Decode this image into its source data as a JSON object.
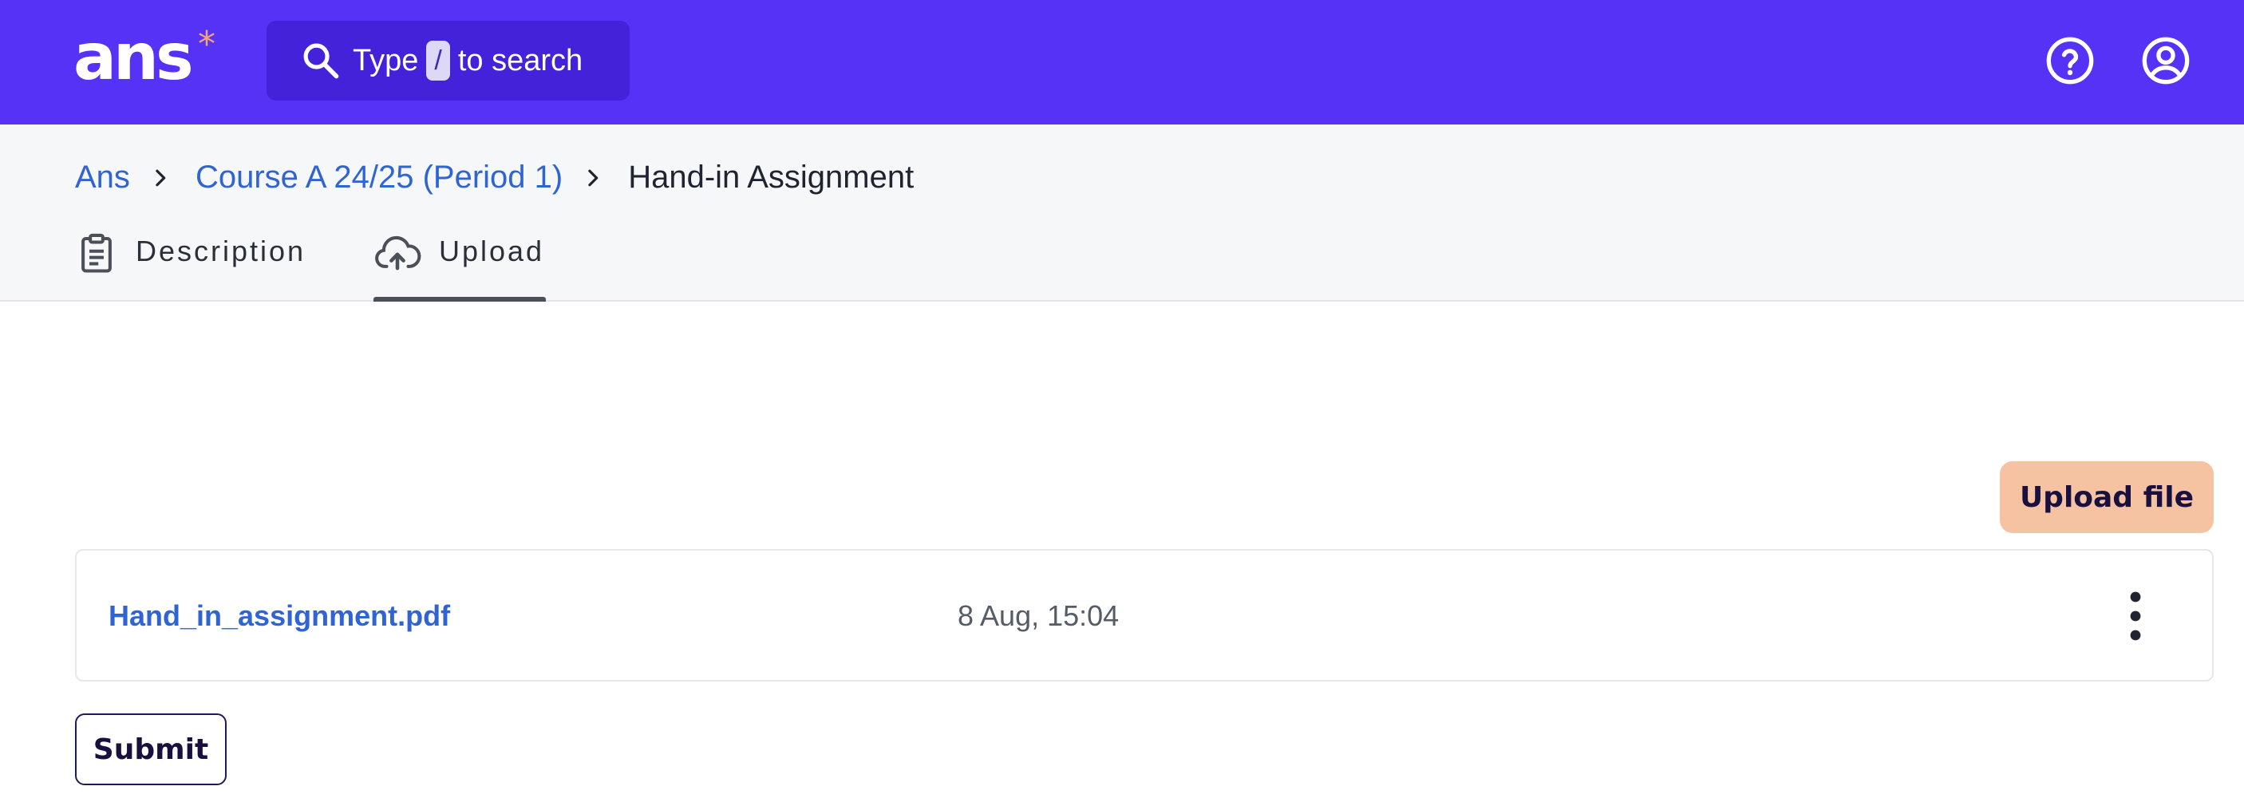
{
  "app": {
    "logo_text": "ans",
    "logo_star": "*",
    "colors": {
      "brand": "#5532f6",
      "accent_star": "#f5a37a",
      "link": "#2f64d2",
      "upload_button_bg": "#f5c2a2"
    }
  },
  "search": {
    "prefix": "Type",
    "shortcut_key": "/",
    "suffix": "to search",
    "icon": "search-icon"
  },
  "header_icons": {
    "help": "help-circle-icon",
    "account": "user-circle-icon"
  },
  "breadcrumb": {
    "items": [
      {
        "label": "Ans",
        "link": true
      },
      {
        "label": "Course A 24/25 (Period 1)",
        "link": true
      },
      {
        "label": "Hand-in Assignment",
        "link": false
      }
    ],
    "separator_icon": "chevron-right-icon"
  },
  "tabs": [
    {
      "label": "Description",
      "icon": "clipboard-icon",
      "active": false
    },
    {
      "label": "Upload",
      "icon": "cloud-upload-icon",
      "active": true
    }
  ],
  "upload": {
    "upload_button_label": "Upload file",
    "files": [
      {
        "name": "Hand_in_assignment.pdf",
        "date": "8 Aug, 15:04",
        "menu_icon": "more-vertical-icon"
      }
    ],
    "submit_label": "Submit"
  }
}
